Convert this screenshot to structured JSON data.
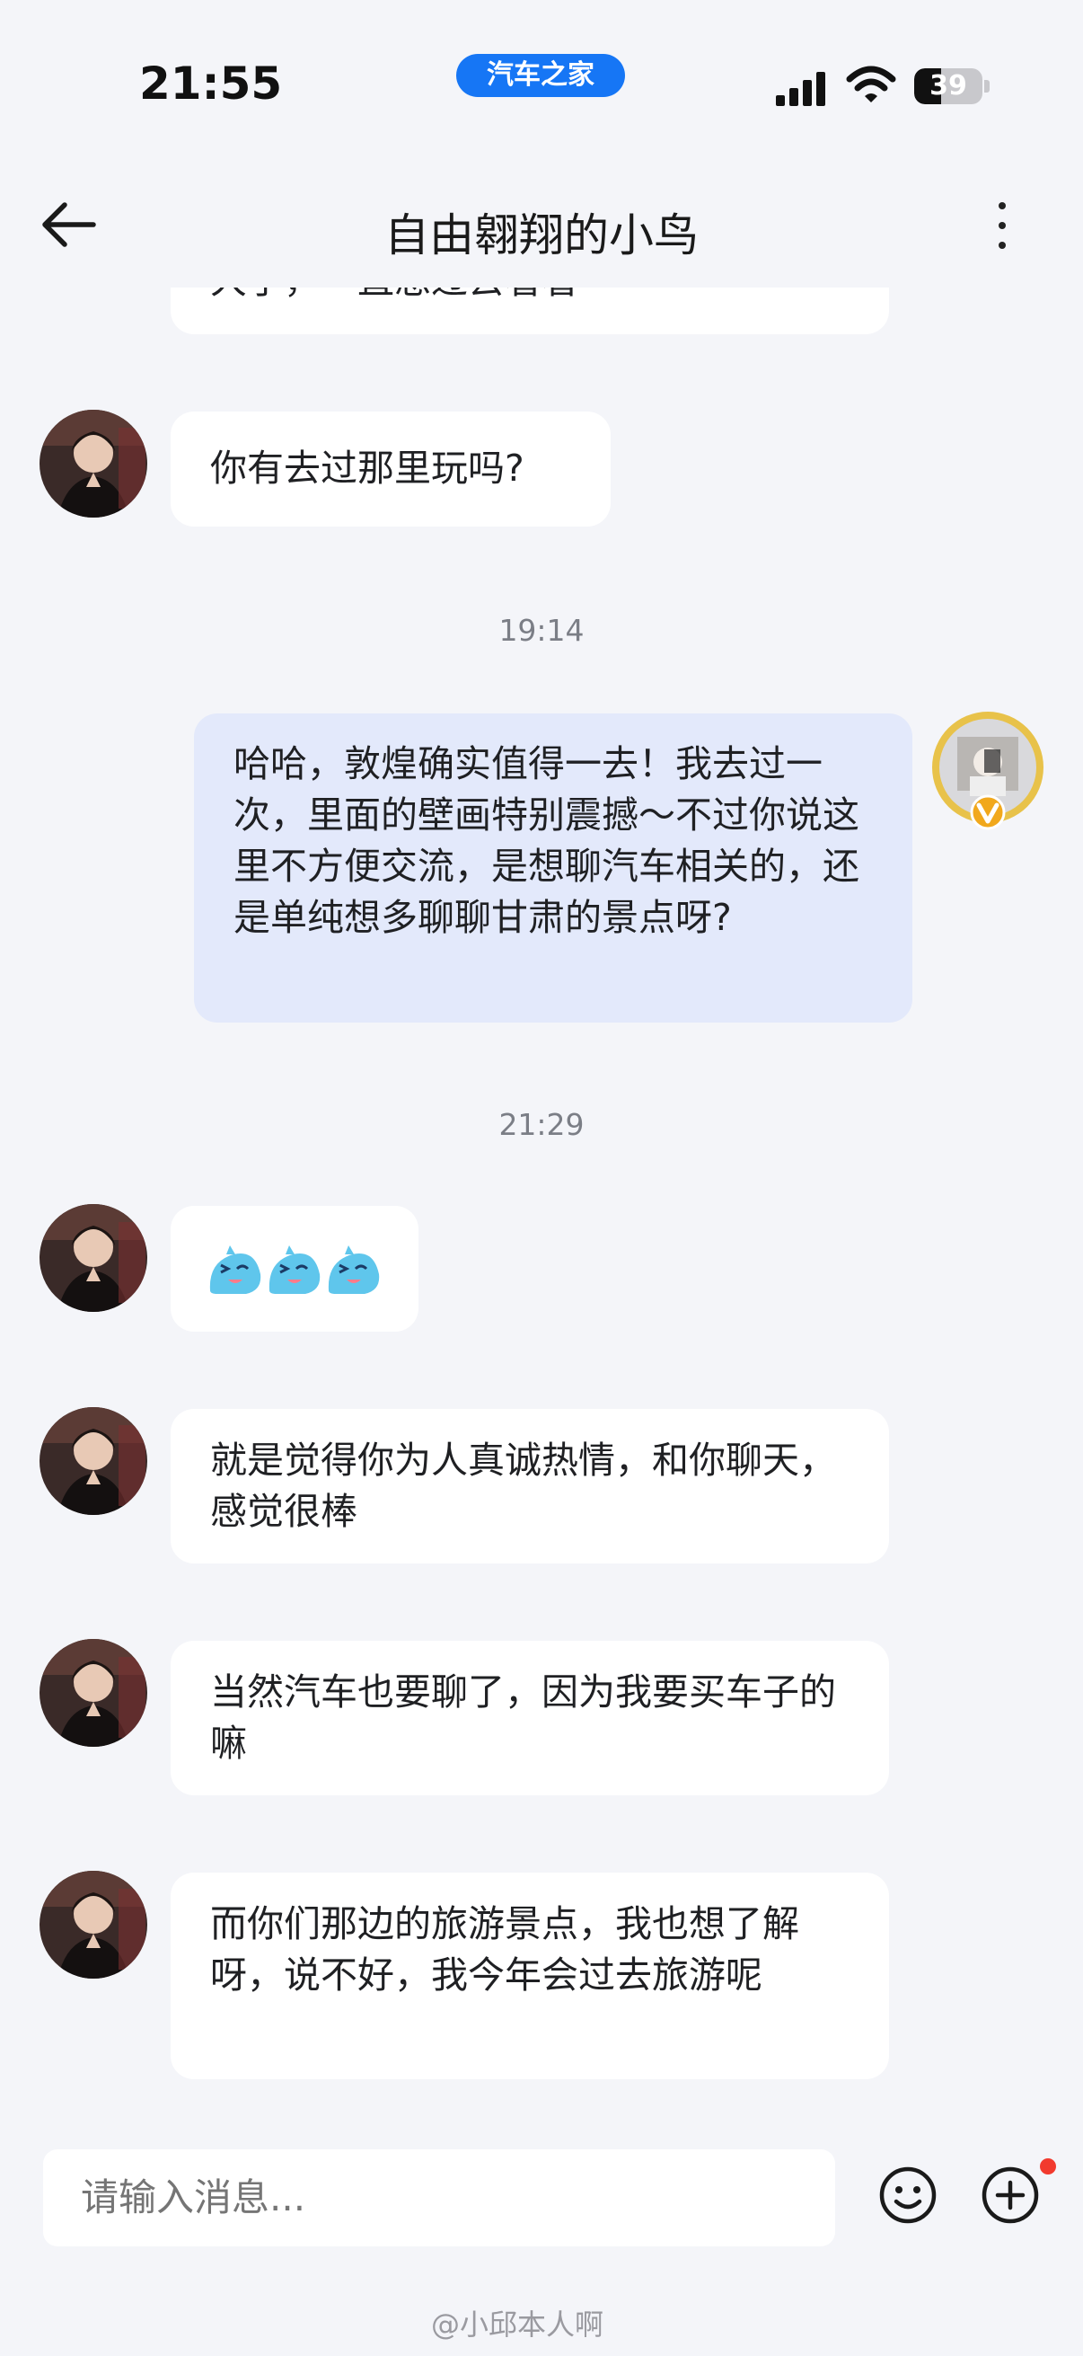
{
  "status_bar": {
    "time": "21:55",
    "app_badge": "汽车之家",
    "battery": "39"
  },
  "header": {
    "title": "自由翱翔的小鸟"
  },
  "messages": {
    "m0": "大了，一直想过去看看",
    "m1": "你有去过那里玩吗?",
    "ts1": "19:14",
    "m2": "哈哈，敦煌确实值得一去！我去过一次，里面的壁画特别震撼～不过你说这里不方便交流，是想聊汽车相关的，还是单纯想多聊聊甘肃的景点呀?",
    "ts2": "21:29",
    "m4": "就是觉得你为人真诚热情，和你聊天，感觉很棒",
    "m5": "当然汽车也要聊了，因为我要买车子的嘛",
    "m6": "而你们那边的旅游景点，我也想了解呀，说不好，我今年会过去旅游呢"
  },
  "input": {
    "placeholder": "请输入消息..."
  },
  "watermark": "@小邱本人啊",
  "colors": {
    "accent": "#1676f5",
    "my_bubble": "#e3e9fb",
    "their_bubble": "#ffffff",
    "background": "#f4f5f9",
    "badge_dot": "#f23a2e"
  },
  "icons": [
    "back-arrow-icon",
    "more-vertical-icon",
    "emoji-icon",
    "plus-circle-icon",
    "wink-sticker-icon",
    "verified-v-icon"
  ]
}
